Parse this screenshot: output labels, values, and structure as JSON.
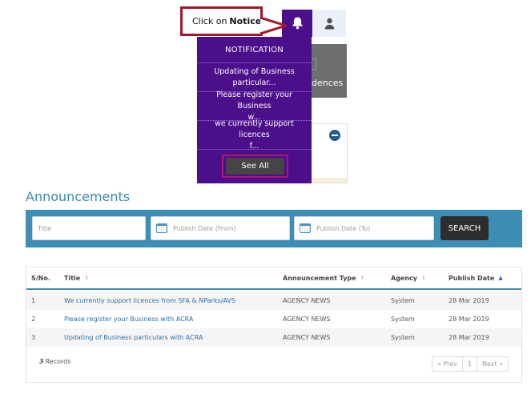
{
  "callout": {
    "prefix": "Click on",
    "emphasis": "Notice"
  },
  "header": {
    "bell_icon": "bell-icon",
    "user_icon": "user-icon"
  },
  "background": {
    "card_text": "dences"
  },
  "notification": {
    "title": "NOTIFICATION",
    "items": [
      {
        "line1": "Updating of Business",
        "line2": "particular..."
      },
      {
        "line1": "Please register your Business",
        "line2": "w..."
      },
      {
        "line1": "we currently support licences",
        "line2": "f..."
      }
    ],
    "see_all_label": "See All"
  },
  "announcements": {
    "title": "Announcements",
    "search": {
      "title_placeholder": "Title",
      "from_placeholder": "Publish Date (From)",
      "to_placeholder": "Publish Date (To)",
      "button_label": "SEARCH"
    },
    "table": {
      "columns": [
        "S/No.",
        "Title",
        "Announcement Type",
        "Agency",
        "Publish Date"
      ],
      "sorted_column": "Publish Date",
      "sort_direction": "ascending",
      "rows": [
        {
          "no": "1",
          "title": "We currently support licences from SFA & NParks/AVS",
          "type": "AGENCY NEWS",
          "agency": "System",
          "date": "28 Mar 2019"
        },
        {
          "no": "2",
          "title": "Please register your Business with ACRA",
          "type": "AGENCY NEWS",
          "agency": "System",
          "date": "28 Mar 2019"
        },
        {
          "no": "3",
          "title": "Updating of Business particulars with ACRA",
          "type": "AGENCY NEWS",
          "agency": "System",
          "date": "28 Mar 2019"
        }
      ]
    },
    "records": {
      "count": "3",
      "label": "Records"
    },
    "pager": {
      "prev": "« Prev",
      "page": "1",
      "next": "Next »"
    }
  },
  "colors": {
    "notification_bg": "#4b0f8c",
    "accent_blue": "#3e8db5",
    "callout_border": "#a3172b",
    "see_all_border": "#b5156f"
  }
}
